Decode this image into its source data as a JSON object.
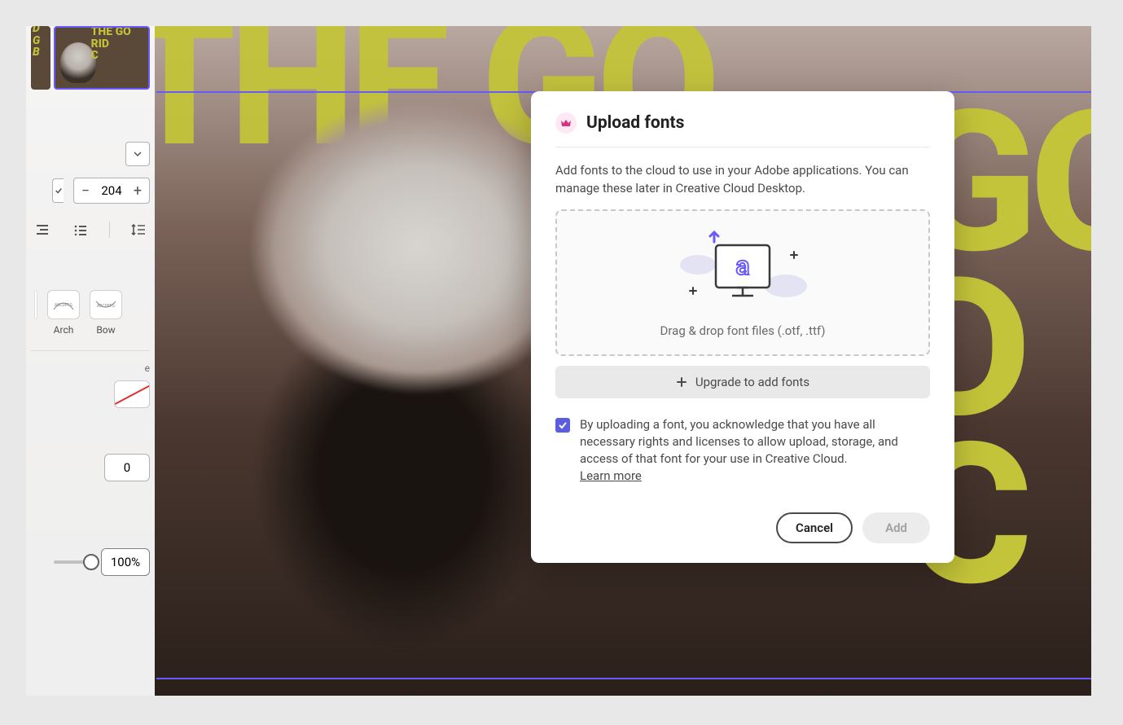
{
  "canvas": {
    "bg_text_top": "THE GO",
    "bg_text_right": "GO\nD\nC"
  },
  "sidebar": {
    "thumb_a_text": "D\nG\nB",
    "thumb_b_text": "THE GO\nRID\nC",
    "stepper_value": "204",
    "shapes": {
      "arch": "Arch",
      "bow": "Bow"
    },
    "section_label": "e",
    "number_value": "0",
    "opacity_value": "100%"
  },
  "modal": {
    "title": "Upload fonts",
    "description": "Add fonts to the cloud to use in your Adobe applications. You can manage these later in Creative Cloud Desktop.",
    "drop_text": "Drag & drop font files (.otf, .ttf)",
    "upgrade_label": "Upgrade to add fonts",
    "consent_text": "By uploading a font, you acknowledge that you have all necessary rights and licenses to allow upload, storage, and access of that font for your use in Creative Cloud.",
    "learn_more": "Learn more",
    "cancel_label": "Cancel",
    "add_label": "Add",
    "consent_checked": true
  }
}
